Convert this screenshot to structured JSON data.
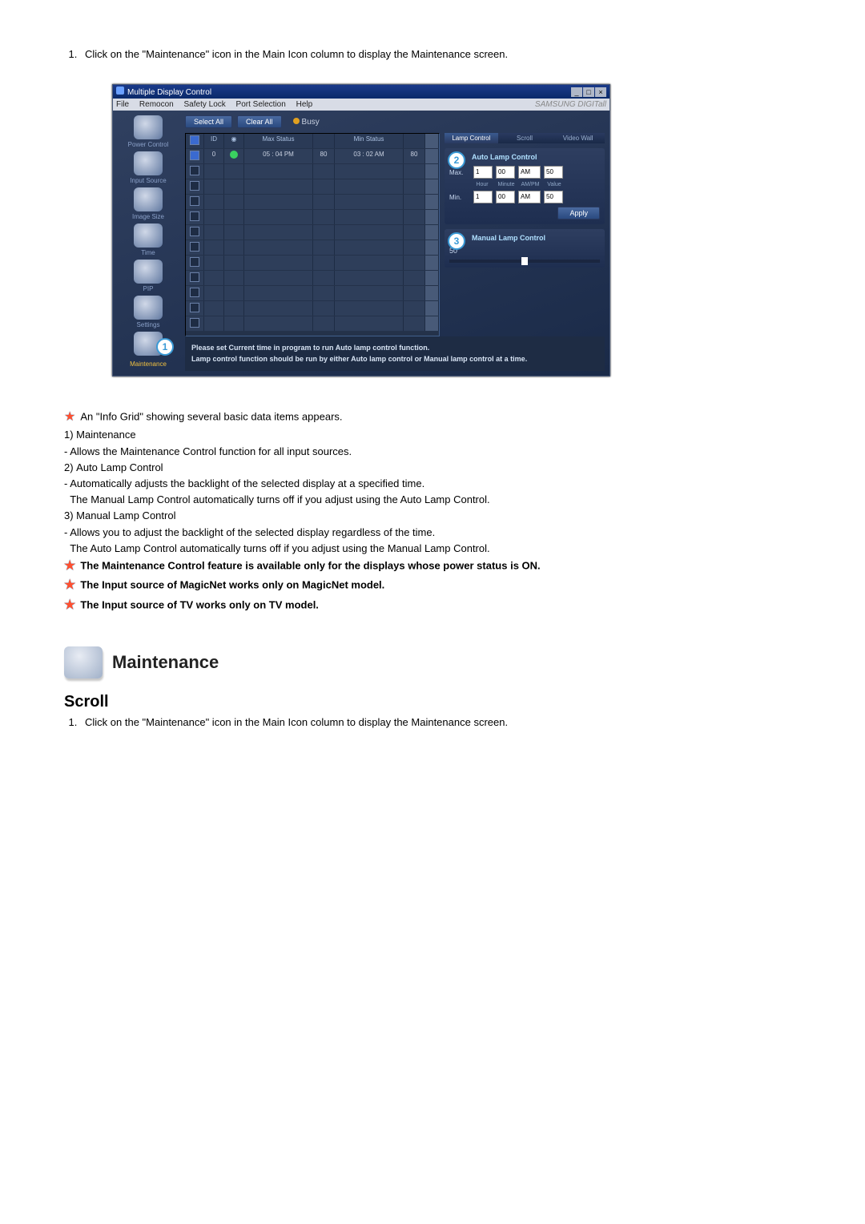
{
  "intro_step": "Click on the \"Maintenance\" icon in the Main Icon column to display the Maintenance screen.",
  "app": {
    "title": "Multiple Display Control",
    "menus": [
      "File",
      "Remocon",
      "Safety Lock",
      "Port Selection",
      "Help"
    ],
    "brand": "SAMSUNG DIGITall",
    "toolbar": {
      "select_all": "Select All",
      "clear_all": "Clear All",
      "busy": "Busy"
    },
    "sidebar": [
      {
        "label": "Power Control"
      },
      {
        "label": "Input Source"
      },
      {
        "label": "Image Size"
      },
      {
        "label": "Time"
      },
      {
        "label": "PIP"
      },
      {
        "label": "Settings"
      },
      {
        "label": "Maintenance",
        "active": true,
        "badge": "1"
      }
    ],
    "grid": {
      "headers": {
        "id": "ID",
        "max": "Max Status",
        "min": "Min Status"
      },
      "row": {
        "id": "0",
        "max_time": "05 : 04 PM",
        "max_val": "80",
        "min_time": "03 : 02 AM",
        "min_val": "80"
      }
    },
    "tabs": {
      "lamp": "Lamp Control",
      "scroll": "Scroll",
      "video": "Video Wall"
    },
    "panel_auto": {
      "badge": "2",
      "title": "Auto Lamp Control",
      "max": "Max.",
      "min": "Min.",
      "hour": "1",
      "minute": "00",
      "ampm": "AM",
      "value": "50",
      "labels": {
        "hour": "Hour",
        "minute": "Minute",
        "ampm": "AM/PM",
        "value": "Value"
      },
      "apply": "Apply"
    },
    "panel_manual": {
      "badge": "3",
      "title": "Manual Lamp Control",
      "value": "50"
    },
    "footer": {
      "line1": "Please set Current time in program to run Auto lamp control function.",
      "line2": "Lamp control function should be run by either Auto lamp control or Manual lamp control at a time."
    }
  },
  "notes": {
    "info_grid": "An \"Info Grid\" showing several basic data items appears.",
    "n1_title": "Maintenance",
    "n1_sub": "Allows the Maintenance Control function for all input sources.",
    "n2_title": "Auto Lamp Control",
    "n2_sub1": "Automatically adjusts the backlight of the selected display at a specified time.",
    "n2_sub2": "The Manual Lamp Control automatically turns off if you adjust using the Auto Lamp Control.",
    "n3_title": "Manual Lamp Control",
    "n3_sub1": "Allows you to adjust the backlight of the selected display regardless of the time.",
    "n3_sub2": "The Auto Lamp Control automatically turns off if you adjust using the Manual Lamp Control.",
    "b1": "The Maintenance Control feature is available only for the displays whose power status is ON.",
    "b2": "The Input source of MagicNet works only on MagicNet model.",
    "b3": "The Input source of TV works only on TV model."
  },
  "section2": {
    "title": "Maintenance",
    "sub": "Scroll",
    "step": "Click on the \"Maintenance\" icon in the Main Icon column to display the Maintenance screen."
  }
}
